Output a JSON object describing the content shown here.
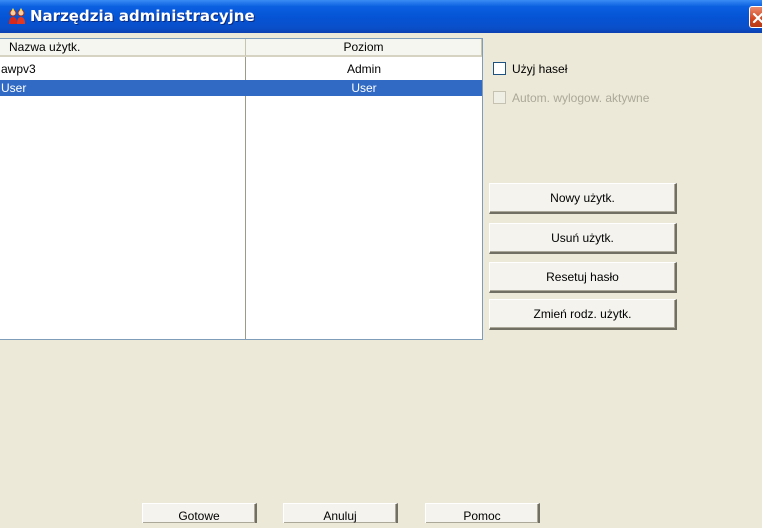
{
  "window": {
    "title": "Narzędzia administracyjne",
    "app_icon": "group-users-icon",
    "close_icon": "close-icon",
    "colors": {
      "titlebar": "#0553d4",
      "close": "#d2461e",
      "selection": "#316ac5",
      "face": "#ece9d8"
    }
  },
  "users_table": {
    "columns": [
      "Nazwa użytk.",
      "Poziom"
    ],
    "rows": [
      {
        "name": "awpv3",
        "level": "Admin",
        "selected": false
      },
      {
        "name": "User",
        "level": "User",
        "selected": true
      }
    ]
  },
  "options": {
    "use_passwords": {
      "label": "Użyj haseł",
      "checked": false,
      "enabled": true
    },
    "auto_logout": {
      "label": "Autom. wylogow. aktywne",
      "checked": false,
      "enabled": false
    }
  },
  "actions": {
    "new_user": "Nowy użytk.",
    "delete_user": "Usuń użytk.",
    "reset_password": "Resetuj hasło",
    "change_user_type": "Zmień rodz. użytk."
  },
  "footer": {
    "done": "Gotowe",
    "cancel": "Anuluj",
    "help": "Pomoc"
  }
}
